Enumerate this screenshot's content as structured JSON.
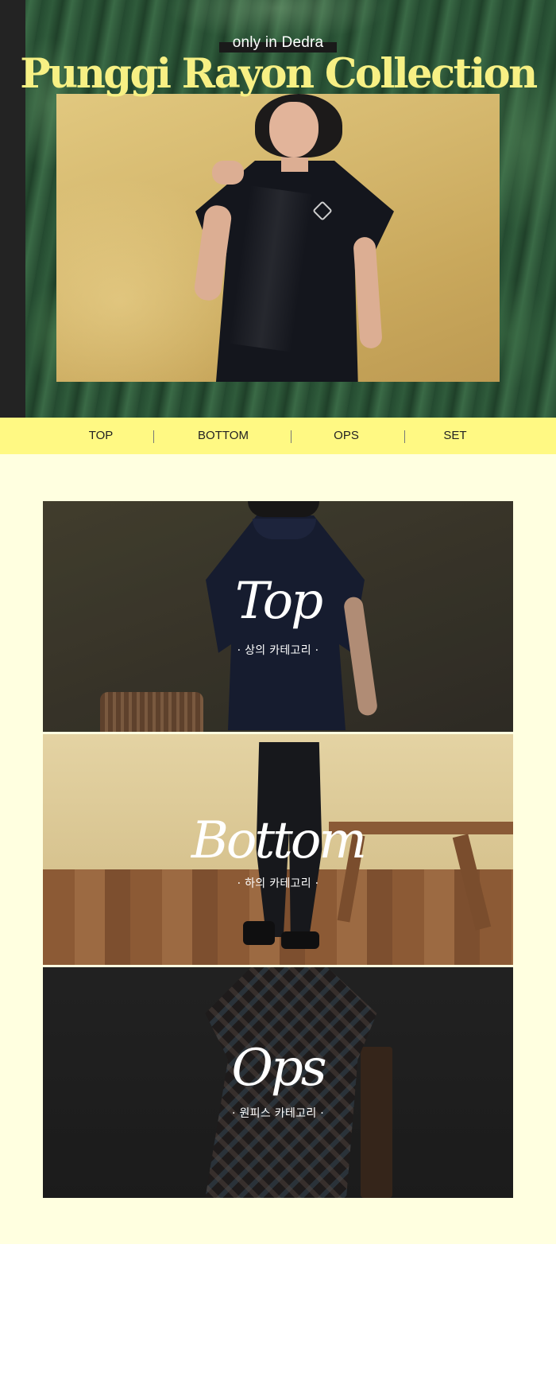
{
  "hero": {
    "subtitle": "only in Dedra",
    "title": "Punggi Rayon Collection",
    "title_color": "#f7f084"
  },
  "nav": {
    "items": [
      {
        "label": "TOP"
      },
      {
        "label": "BOTTOM"
      },
      {
        "label": "OPS"
      },
      {
        "label": "SET"
      }
    ],
    "background": "#fff983"
  },
  "categories": [
    {
      "title": "Top",
      "subtitle": "· 상의 카테고리 ·"
    },
    {
      "title": "Bottom",
      "subtitle": "· 하의 카테고리 ·"
    },
    {
      "title": "Ops",
      "subtitle": "· 원피스 카테고리 ·"
    }
  ],
  "colors": {
    "section_background": "#ffffe0",
    "sidebar": "#232323"
  }
}
